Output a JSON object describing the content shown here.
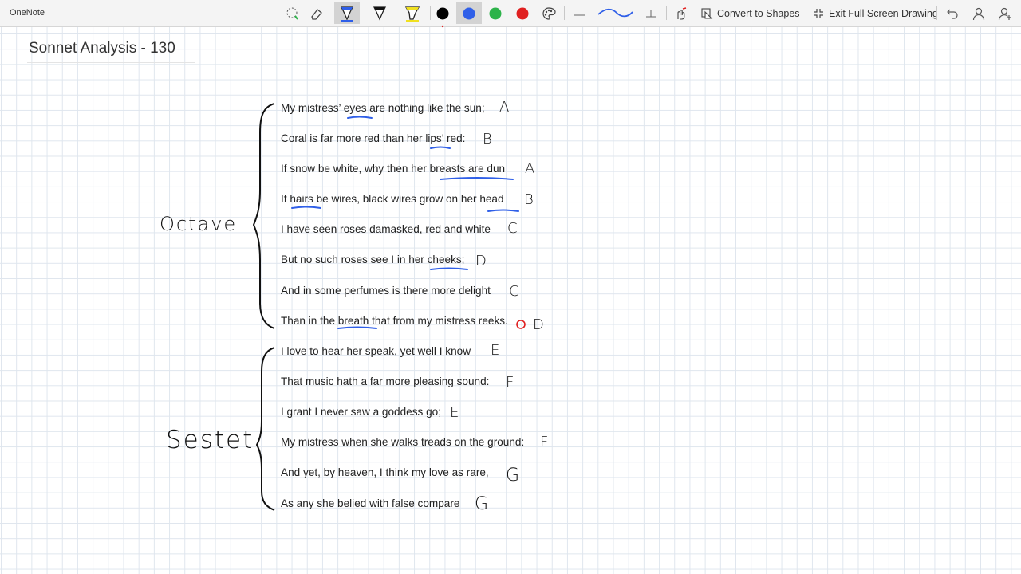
{
  "app": {
    "name": "OneNote"
  },
  "toolbar": {
    "tools": [
      {
        "name": "lasso-select"
      },
      {
        "name": "eraser"
      },
      {
        "name": "pen-selected"
      },
      {
        "name": "pen"
      },
      {
        "name": "highlighter"
      }
    ],
    "colors": [
      "#000000",
      "#2f5fe8",
      "#2db34a",
      "#e02020"
    ],
    "convert_label": "Convert to Shapes",
    "exit_label": "Exit Full Screen Drawing"
  },
  "page": {
    "title": "Sonnet Analysis - 130"
  },
  "poem": {
    "lines": [
      "My mistress’ eyes are nothing like the sun;",
      "Coral is far more red than her lips’ red:",
      "If snow be white, why then her breasts are dun",
      "If hairs be wires, black wires grow on her head",
      "I have seen roses damasked, red and white",
      "But no such roses see I in her cheeks;",
      "And in some perfumes is there more delight",
      "Than in the breath that from my mistress reeks.",
      "I love to hear her speak, yet well I know",
      "That music hath a far more pleasing sound:",
      "I grant I never saw a goddess go;",
      "My mistress when she walks treads on the ground:",
      "And yet, by heaven, I think my love as rare,",
      "As any she belied with false compare"
    ],
    "rhymes": [
      "A",
      "B",
      "A",
      "B",
      "C",
      "D",
      "C",
      "D",
      "E",
      "F",
      "E",
      "F",
      "G",
      "G"
    ]
  },
  "sections": {
    "octave": "Octave",
    "sestet": "Sestet"
  }
}
